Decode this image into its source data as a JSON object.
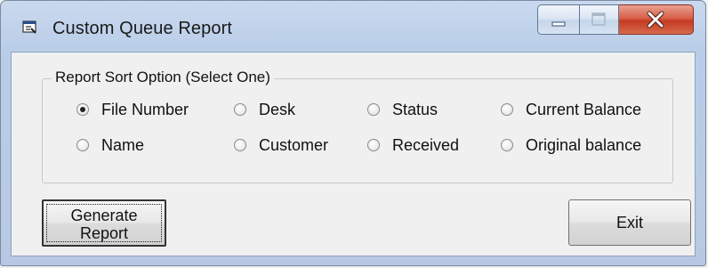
{
  "window": {
    "title": "Custom Queue Report",
    "icons": {
      "app": "report-window-icon",
      "minimize": "minimize-icon",
      "maximize": "maximize-icon",
      "close": "close-icon"
    },
    "colors": {
      "titlebar": "#b9cde8",
      "close_button": "#c43a22",
      "client_bg": "#f0f0f0"
    }
  },
  "sort_options": {
    "legend": "Report Sort Option (Select One)",
    "selected": "File Number",
    "items": [
      {
        "label": "File Number",
        "checked": true
      },
      {
        "label": "Desk",
        "checked": false
      },
      {
        "label": "Status",
        "checked": false
      },
      {
        "label": "Current Balance",
        "checked": false
      },
      {
        "label": "Name",
        "checked": false
      },
      {
        "label": "Customer",
        "checked": false
      },
      {
        "label": "Received",
        "checked": false
      },
      {
        "label": "Original balance",
        "checked": false
      }
    ]
  },
  "buttons": {
    "generate_label": "Generate\nReport",
    "exit_label": "Exit"
  }
}
